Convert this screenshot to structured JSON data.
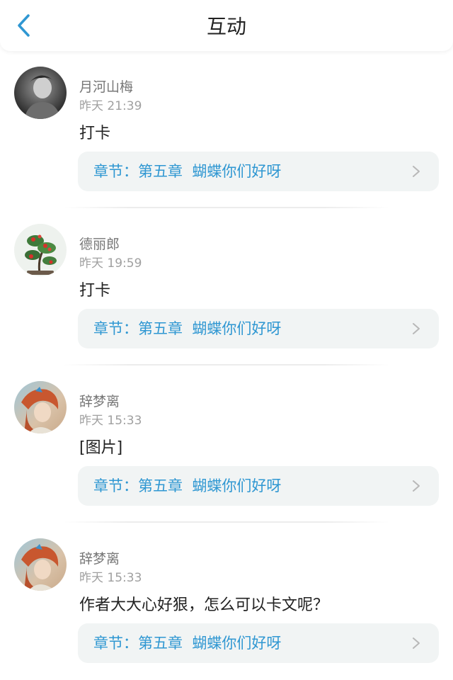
{
  "header": {
    "title": "互动",
    "back_icon": "chevron-left-icon",
    "accent_color": "#2f97d2"
  },
  "comments": [
    {
      "username": "月河山梅",
      "timestamp": "昨天 21:39",
      "text": "打卡",
      "chapter_label": "章节：第五章  蝴蝶你们好呀",
      "avatar": "photo-portrait"
    },
    {
      "username": "德丽郎",
      "timestamp": "昨天 19:59",
      "text": "打卡",
      "chapter_label": "章节：第五章  蝴蝶你们好呀",
      "avatar": "plant-bonsai"
    },
    {
      "username": "辞梦离",
      "timestamp": "昨天 15:33",
      "text": "[图片]",
      "chapter_label": "章节：第五章  蝴蝶你们好呀",
      "avatar": "illustrated-girl"
    },
    {
      "username": "辞梦离",
      "timestamp": "昨天 15:33",
      "text": "作者大大心好狠，怎么可以卡文呢？",
      "chapter_label": "章节：第五章  蝴蝶你们好呀",
      "avatar": "illustrated-girl"
    }
  ]
}
